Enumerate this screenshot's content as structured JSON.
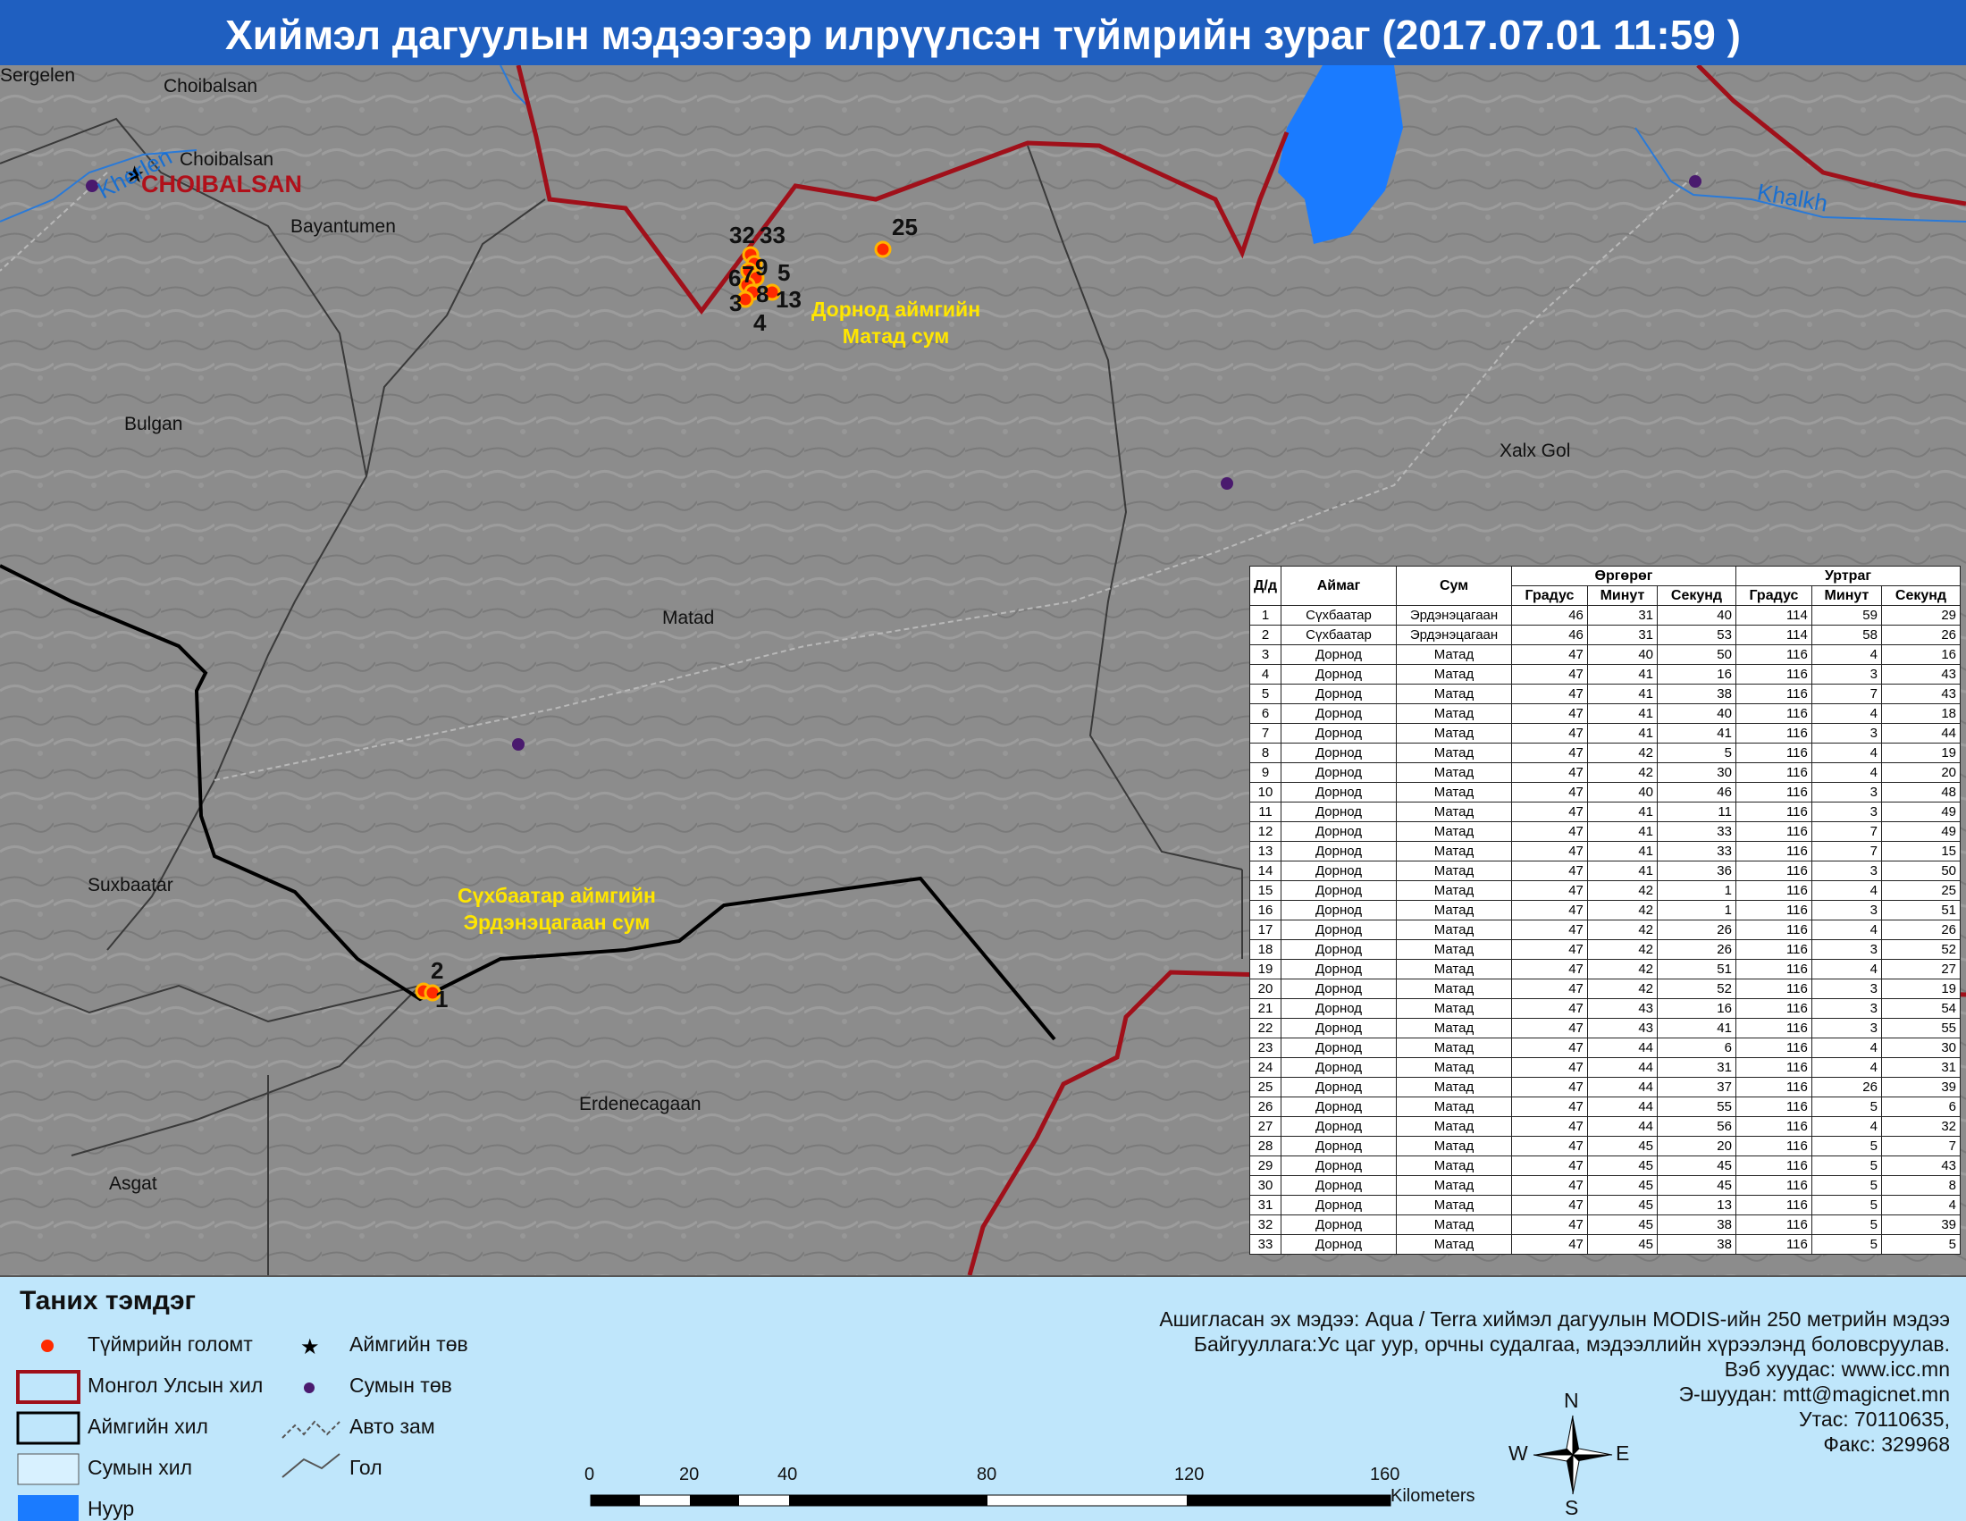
{
  "title": "Хиймэл дагуулын мэдээгээр илрүүлсэн түймрийн зураг  (2017.07.01  11:59 )",
  "map": {
    "places": [
      "Sergelen",
      "Choibalsan",
      "Choibalsan",
      "Bayantumen",
      "Bulgan",
      "Matad",
      "Xalx Gol",
      "Suxbaatar",
      "Erdenecagaan",
      "Asgat"
    ],
    "aimag_center": "CHOIBALSAN",
    "rivers": [
      "Kherlen",
      "Khalkh"
    ],
    "sum_labels": [
      {
        "line1": "Дорнод аймгийн",
        "line2": "Матад сум"
      },
      {
        "line1": "Сүхбаатар аймгийн",
        "line2": "Эрдэнэцагаан сум"
      }
    ],
    "fire_labels": [
      "32",
      "33",
      "25",
      "9",
      "5",
      "6",
      "7",
      "8",
      "13",
      "3",
      "4",
      "2",
      "1"
    ]
  },
  "table": {
    "headers": {
      "id": "Д/д",
      "aimag": "Аймаг",
      "sum": "Сум",
      "lat_group": "Өргөрөг",
      "lon_group": "Уртраг",
      "deg": "Градус",
      "min": "Минут",
      "sec": "Секунд"
    },
    "rows": [
      [
        1,
        "Сүхбаатар",
        "Эрдэнэцагаан",
        46,
        31,
        40,
        114,
        59,
        29
      ],
      [
        2,
        "Сүхбаатар",
        "Эрдэнэцагаан",
        46,
        31,
        53,
        114,
        58,
        26
      ],
      [
        3,
        "Дорнод",
        "Матад",
        47,
        40,
        50,
        116,
        4,
        16
      ],
      [
        4,
        "Дорнод",
        "Матад",
        47,
        41,
        16,
        116,
        3,
        43
      ],
      [
        5,
        "Дорнод",
        "Матад",
        47,
        41,
        38,
        116,
        7,
        43
      ],
      [
        6,
        "Дорнод",
        "Матад",
        47,
        41,
        40,
        116,
        4,
        18
      ],
      [
        7,
        "Дорнод",
        "Матад",
        47,
        41,
        41,
        116,
        3,
        44
      ],
      [
        8,
        "Дорнод",
        "Матад",
        47,
        42,
        5,
        116,
        4,
        19
      ],
      [
        9,
        "Дорнод",
        "Матад",
        47,
        42,
        30,
        116,
        4,
        20
      ],
      [
        10,
        "Дорнод",
        "Матад",
        47,
        40,
        46,
        116,
        3,
        48
      ],
      [
        11,
        "Дорнод",
        "Матад",
        47,
        41,
        11,
        116,
        3,
        49
      ],
      [
        12,
        "Дорнод",
        "Матад",
        47,
        41,
        33,
        116,
        7,
        49
      ],
      [
        13,
        "Дорнод",
        "Матад",
        47,
        41,
        33,
        116,
        7,
        15
      ],
      [
        14,
        "Дорнод",
        "Матад",
        47,
        41,
        36,
        116,
        3,
        50
      ],
      [
        15,
        "Дорнод",
        "Матад",
        47,
        42,
        1,
        116,
        4,
        25
      ],
      [
        16,
        "Дорнод",
        "Матад",
        47,
        42,
        1,
        116,
        3,
        51
      ],
      [
        17,
        "Дорнод",
        "Матад",
        47,
        42,
        26,
        116,
        4,
        26
      ],
      [
        18,
        "Дорнод",
        "Матад",
        47,
        42,
        26,
        116,
        3,
        52
      ],
      [
        19,
        "Дорнод",
        "Матад",
        47,
        42,
        51,
        116,
        4,
        27
      ],
      [
        20,
        "Дорнод",
        "Матад",
        47,
        42,
        52,
        116,
        3,
        19
      ],
      [
        21,
        "Дорнод",
        "Матад",
        47,
        43,
        16,
        116,
        3,
        54
      ],
      [
        22,
        "Дорнод",
        "Матад",
        47,
        43,
        41,
        116,
        3,
        55
      ],
      [
        23,
        "Дорнод",
        "Матад",
        47,
        44,
        6,
        116,
        4,
        30
      ],
      [
        24,
        "Дорнод",
        "Матад",
        47,
        44,
        31,
        116,
        4,
        31
      ],
      [
        25,
        "Дорнод",
        "Матад",
        47,
        44,
        37,
        116,
        26,
        39
      ],
      [
        26,
        "Дорнод",
        "Матад",
        47,
        44,
        55,
        116,
        5,
        6
      ],
      [
        27,
        "Дорнод",
        "Матад",
        47,
        44,
        56,
        116,
        4,
        32
      ],
      [
        28,
        "Дорнод",
        "Матад",
        47,
        45,
        20,
        116,
        5,
        7
      ],
      [
        29,
        "Дорнод",
        "Матад",
        47,
        45,
        45,
        116,
        5,
        43
      ],
      [
        30,
        "Дорнод",
        "Матад",
        47,
        45,
        45,
        116,
        5,
        8
      ],
      [
        31,
        "Дорнод",
        "Матад",
        47,
        45,
        13,
        116,
        5,
        4
      ],
      [
        32,
        "Дорнод",
        "Матад",
        47,
        45,
        38,
        116,
        5,
        39
      ],
      [
        33,
        "Дорнод",
        "Матад",
        47,
        45,
        38,
        116,
        5,
        5
      ]
    ]
  },
  "legend": {
    "title": "Таних тэмдэг",
    "items": {
      "fire": "Түймрийн голомт",
      "national_border": "Монгол Улсын хил",
      "aimag_border": "Аймгийн хил",
      "sum_border": "Сумын хил",
      "lake": "Нуур",
      "aimag_center": "Аймгийн төв",
      "sum_center": "Сумын төв",
      "road": "Авто зам",
      "river": "Гол"
    }
  },
  "credits": {
    "source": "Ашигласан эх мэдээ: Aqua / Terra хиймэл дагуулын MODIS-ийн 250 метрийн мэдээ",
    "org": "Байгууллага:Ус цаг уур, орчны судалгаа, мэдээллийн хүрээлэнд боловсруулав.",
    "web": "Вэб хуудас: www.icc.mn",
    "email": "Э-шуудан: mtt@magicnet.mn",
    "phone": "Утас: 70110635,",
    "fax": "Факс: 329968"
  },
  "scale": {
    "ticks": [
      "0",
      "20",
      "40",
      "80",
      "120",
      "160"
    ],
    "unit": "Kilometers"
  },
  "compass": {
    "n": "N",
    "s": "S",
    "e": "E",
    "w": "W"
  },
  "colors": {
    "title_bg": "#1f5fc0",
    "national_border": "#a0101a",
    "aimag_border": "#000000",
    "fire": "#ff2a00",
    "sum_label": "#ffe600",
    "lake": "#1a7bff",
    "legend_bg": "#bfe6fb",
    "sum_center": "#4a1a6e"
  }
}
